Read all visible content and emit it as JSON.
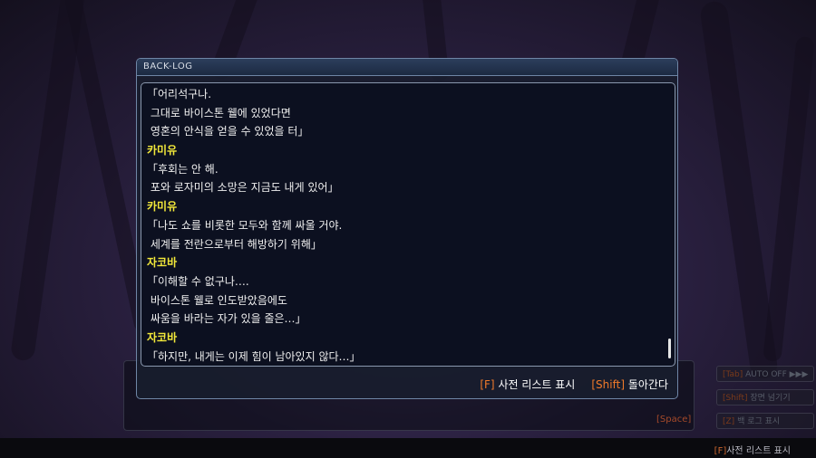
{
  "backlog": {
    "title": "BACK-LOG",
    "lines": [
      {
        "text": "「어리석구나.",
        "speaker": false
      },
      {
        "text": " 그대로 바이스톤 웰에 있었다면",
        "speaker": false
      },
      {
        "text": " 영혼의 안식을 얻을 수 있었을 터」",
        "speaker": false
      },
      {
        "text": "카미유",
        "speaker": true
      },
      {
        "text": "「후회는 안 해.",
        "speaker": false
      },
      {
        "text": " 포와 로자미의 소망은 지금도 내게 있어」",
        "speaker": false
      },
      {
        "text": "카미유",
        "speaker": true
      },
      {
        "text": "「나도 쇼를 비롯한 모두와 함께 싸울 거야.",
        "speaker": false
      },
      {
        "text": " 세계를 전란으로부터 해방하기 위해」",
        "speaker": false
      },
      {
        "text": "자코바",
        "speaker": true
      },
      {
        "text": "「이해할 수 없구나….",
        "speaker": false
      },
      {
        "text": " 바이스톤 웰로 인도받았음에도",
        "speaker": false
      },
      {
        "text": " 싸움을 바라는 자가 있을 줄은…」",
        "speaker": false
      },
      {
        "text": "자코바",
        "speaker": true
      },
      {
        "text": "「하지만, 내게는 이제 힘이 남아있지 않다…」",
        "speaker": false
      }
    ],
    "footer": {
      "dict_key": "[F]",
      "dict_label": "사전 리스트 표시",
      "back_key": "[Shift]",
      "back_label": "돌아간다"
    }
  },
  "side_buttons": [
    {
      "key": "[Tab]",
      "label": "AUTO OFF ▶▶▶"
    },
    {
      "key": "[Shift]",
      "label": "장면 넘기기"
    },
    {
      "key": "[Z]",
      "label": "백 로그 표시"
    }
  ],
  "space_hint": "[Space]",
  "bottom_hint": {
    "key": "[F]",
    "label": "사전 리스트 표시"
  },
  "colors": {
    "speaker": "#f2e83a",
    "key": "#f07a2a",
    "frame": "#6f86a6"
  }
}
